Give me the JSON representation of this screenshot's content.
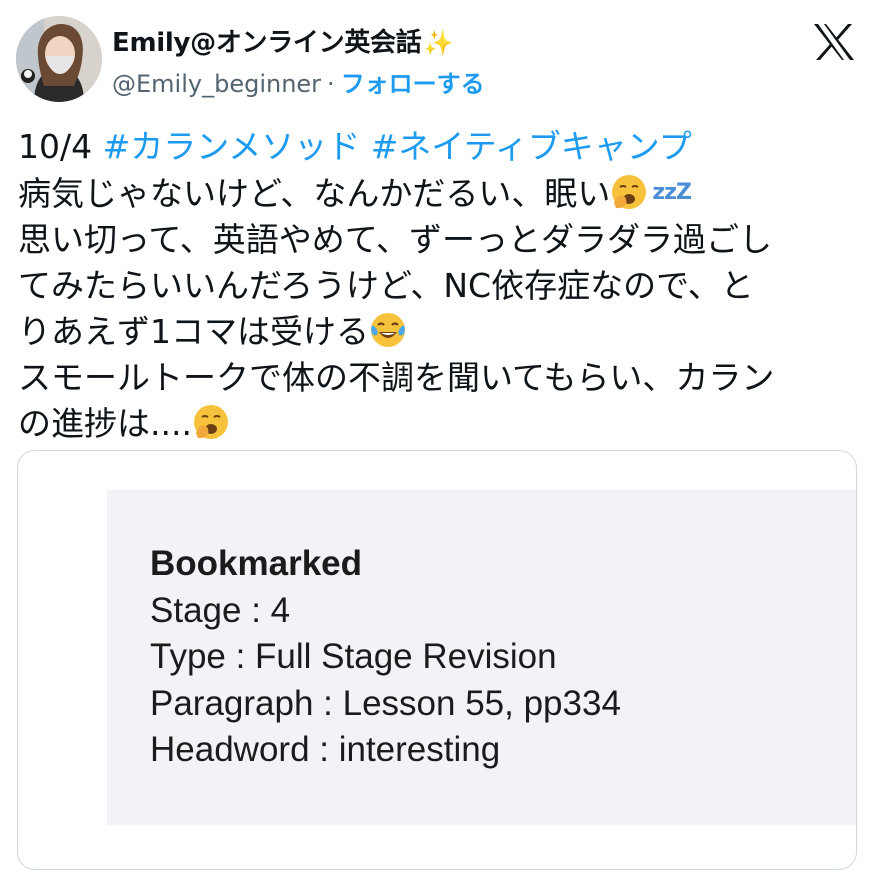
{
  "header": {
    "display_name": "Emily@オンライン英会話",
    "sparkle": "✨",
    "handle": "@Emily_beginner",
    "separator": "·",
    "follow_label": "フォローする",
    "logo_icon": "x-logo-icon"
  },
  "tweet": {
    "lines": [
      {
        "prefix": "10/4 ",
        "hashtag1": "#カランメソッド",
        "hashtag2": "#ネイティブキャンプ"
      },
      {
        "text": "病気じゃないけど、なんかだるい、眠い",
        "emoji": "yawning-face-icon",
        "zzz": "zzZ"
      },
      {
        "text": "思い切って、英語やめて、ずーっとダラダラ過ごし"
      },
      {
        "text": "てみたらいいんだろうけど、NC依存症なので、と"
      },
      {
        "text": "りあえず1コマは受ける",
        "emoji": "tears-of-joy-icon"
      },
      {
        "text": "スモールトークで体の不調を聞いてもらい、カラン"
      },
      {
        "text": "の進捗は....",
        "emoji": "yawning-face-icon"
      }
    ]
  },
  "card": {
    "title": "Bookmarked",
    "stage": "Stage : 4",
    "type": "Type : Full Stage Revision",
    "paragraph": "Paragraph : Lesson 55, pp334",
    "headword": "Headword : interesting"
  }
}
